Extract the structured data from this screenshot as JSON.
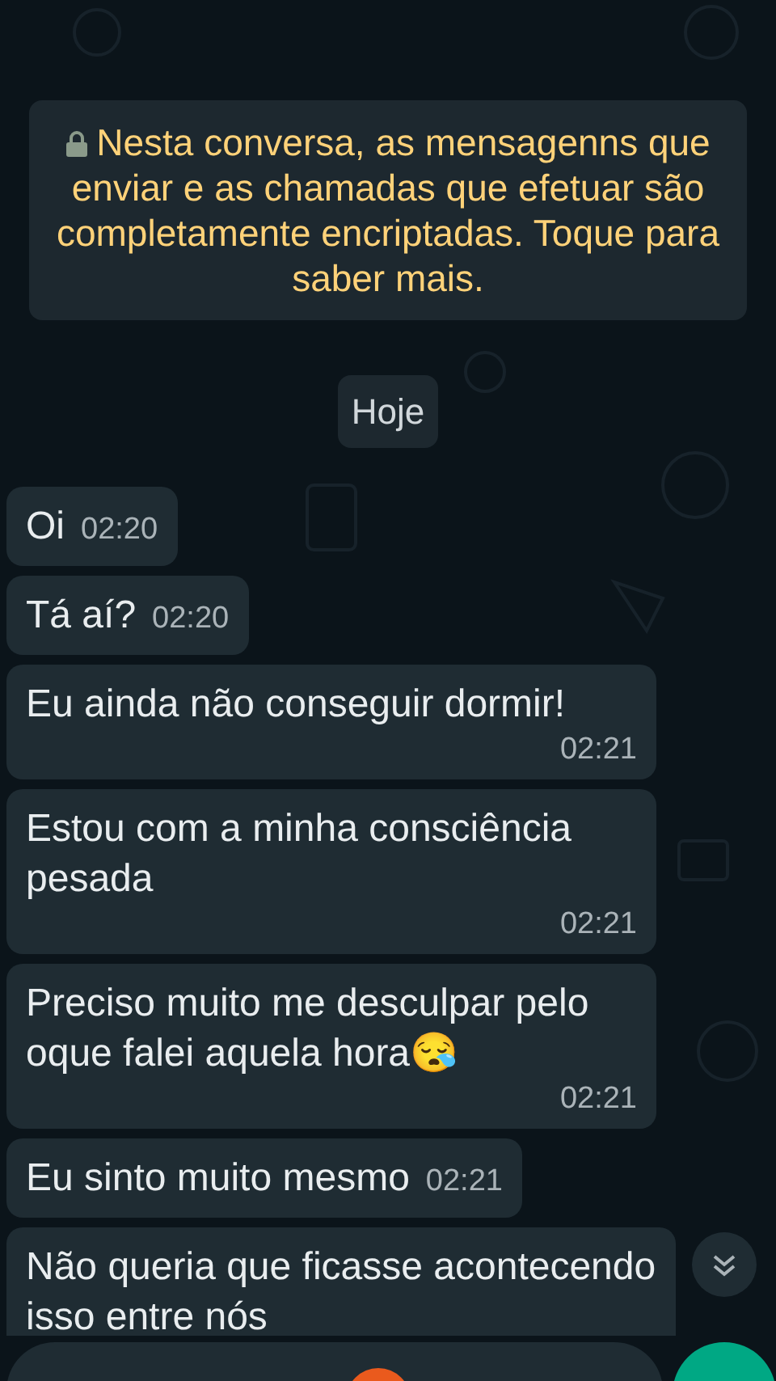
{
  "encryption_notice": {
    "text": "Nesta conversa, as mensagenns que enviar e as chamadas que efetuar são completamente encriptadas. Toque para saber mais."
  },
  "date_chip": "Hoje",
  "messages": [
    {
      "kind": "inline",
      "text": "Oi",
      "time": "02:20"
    },
    {
      "kind": "inline",
      "text": "Tá aí?",
      "time": "02:20"
    },
    {
      "kind": "block",
      "text": "Eu ainda não conseguir dormir!",
      "time": "02:21"
    },
    {
      "kind": "block",
      "text": "Estou com a minha consciência pesada",
      "time": "02:21"
    },
    {
      "kind": "block",
      "text": "Preciso muito me desculpar pelo oque falei aquela hora😪",
      "time": "02:21"
    },
    {
      "kind": "inline",
      "text": "Eu sinto muito mesmo",
      "time": "02:21"
    },
    {
      "kind": "cut",
      "text": "Não queria que ficasse acontecendo isso entre nós"
    }
  ]
}
